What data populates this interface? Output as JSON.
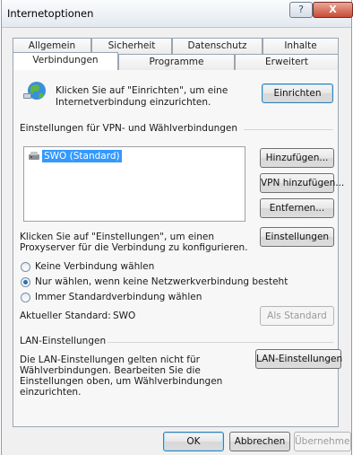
{
  "window": {
    "title": "Internetoptionen",
    "help_label": "?",
    "close_label": "X"
  },
  "tabs_row1": [
    "Allgemein",
    "Sicherheit",
    "Datenschutz",
    "Inhalte"
  ],
  "tabs_row2": [
    "Verbindungen",
    "Programme",
    "Erweitert"
  ],
  "active_tab": "Verbindungen",
  "setup": {
    "text_line1": "Klicken Sie auf \"Einrichten\", um eine",
    "text_line2": "Internetverbindung einzurichten.",
    "button": "Einrichten"
  },
  "vpn": {
    "heading": "Einstellungen für VPN- und Wählverbindungen",
    "items": [
      "SWO (Standard)"
    ],
    "add_button": "Hinzufügen...",
    "add_vpn_button": "VPN hinzufügen...",
    "remove_button": "Entfernen..."
  },
  "proxy": {
    "text_line1": "Klicken Sie auf \"Einstellungen\", um einen",
    "text_line2": "Proxyserver für die Verbindung zu konfigurieren.",
    "button": "Einstellungen"
  },
  "dial_options": [
    {
      "label": "Keine Verbindung wählen",
      "checked": false
    },
    {
      "label": "Nur wählen, wenn keine Netzwerkverbindung besteht",
      "checked": true
    },
    {
      "label": "Immer Standardverbindung wählen",
      "checked": false
    }
  ],
  "current_default": {
    "label": "Aktueller Standard:",
    "value": "SWO",
    "button": "Als Standard"
  },
  "lan": {
    "heading": "LAN-Einstellungen",
    "text_lines": [
      "Die LAN-Einstellungen gelten nicht für",
      "Wählverbindungen. Bearbeiten Sie die",
      "Einstellungen oben, um Wählverbindungen",
      "einzurichten."
    ],
    "button": "LAN-Einstellungen"
  },
  "footer": {
    "ok": "OK",
    "cancel": "Abbrechen",
    "apply": "Übernehmen"
  }
}
